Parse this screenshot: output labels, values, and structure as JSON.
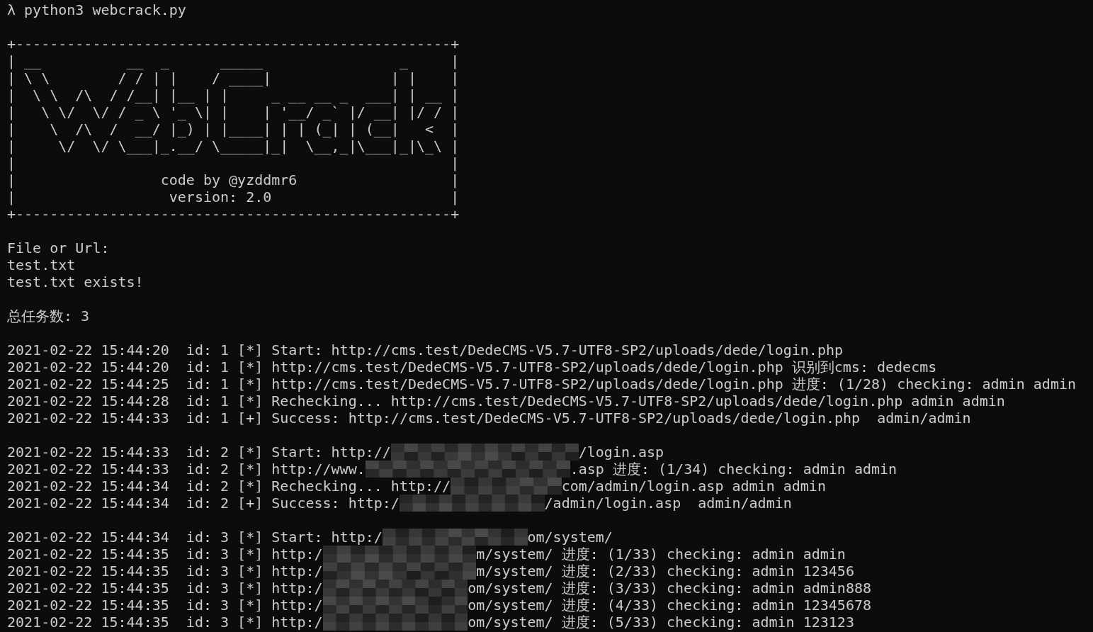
{
  "command": "λ python3 webcrack.py",
  "banner": [
    "+---------------------------------------------------+",
    "| __          __  _      _____                _     |",
    "| \\ \\        / / | |    / ____|              | |    |",
    "|  \\ \\  /\\  / /__| |__ | |     _ __ __ _  ___| | __ |",
    "|   \\ \\/  \\/ / _ \\ '_ \\| |    | '__/ _` |/ __| |/ / |",
    "|    \\  /\\  /  __/ |_) | |____| | | (_| | (__|   <  |",
    "|     \\/  \\/ \\___|_.__/ \\_____|_|  \\__,_|\\___|_|\\_\\ |",
    "|                                                   |",
    "|                 code by @yzddmr6                  |",
    "|                  version: 2.0                     |",
    "+---------------------------------------------------+"
  ],
  "input_prompt": [
    "File or Url:",
    "test.txt",
    "test.txt exists!"
  ],
  "total": "总任务数: 3",
  "tasks": [
    {
      "lines": [
        {
          "text": "2021-02-22 15:44:20  id: 1 [*] Start: http://cms.test/DedeCMS-V5.7-UTF8-SP2/uploads/dede/login.php"
        },
        {
          "text": "2021-02-22 15:44:20  id: 1 [*] http://cms.test/DedeCMS-V5.7-UTF8-SP2/uploads/dede/login.php 识别到cms: dedecms"
        },
        {
          "text": "2021-02-22 15:44:25  id: 1 [*] http://cms.test/DedeCMS-V5.7-UTF8-SP2/uploads/dede/login.php 进度: (1/28) checking: admin admin"
        },
        {
          "text": "2021-02-22 15:44:28  id: 1 [*] Rechecking... http://cms.test/DedeCMS-V5.7-UTF8-SP2/uploads/dede/login.php admin admin"
        },
        {
          "text": "2021-02-22 15:44:33  id: 1 [+] Success: http://cms.test/DedeCMS-V5.7-UTF8-SP2/uploads/dede/login.php  admin/admin"
        }
      ]
    },
    {
      "lines": [
        {
          "text": "2021-02-22 15:44:33  id: 2 [*] Start: http://",
          "tail": "/login.asp"
        },
        {
          "text": "2021-02-22 15:44:33  id: 2 [*] http://www.",
          "tail": ".asp 进度: (1/34) checking: admin admin"
        },
        {
          "text": "2021-02-22 15:44:34  id: 2 [*] Rechecking... http://",
          "tail": "com/admin/login.asp admin admin"
        },
        {
          "text": "2021-02-22 15:44:34  id: 2 [+] Success: http:/",
          "tail": "/admin/login.asp  admin/admin"
        }
      ]
    },
    {
      "lines": [
        {
          "text": "2021-02-22 15:44:34  id: 3 [*] Start: http:/",
          "tail": "om/system/"
        },
        {
          "text": "2021-02-22 15:44:35  id: 3 [*] http:/",
          "tail": "m/system/ 进度: (1/33) checking: admin admin"
        },
        {
          "text": "2021-02-22 15:44:35  id: 3 [*] http:/",
          "tail": "m/system/ 进度: (2/33) checking: admin 123456"
        },
        {
          "text": "2021-02-22 15:44:35  id: 3 [*] http:/",
          "tail": "om/system/ 进度: (3/33) checking: admin admin888"
        },
        {
          "text": "2021-02-22 15:44:35  id: 3 [*] http:/",
          "tail": "om/system/ 进度: (4/33) checking: admin 12345678"
        },
        {
          "text": "2021-02-22 15:44:35  id: 3 [*] http:/",
          "tail": "om/system/ 进度: (5/33) checking: admin 123123"
        }
      ]
    }
  ]
}
